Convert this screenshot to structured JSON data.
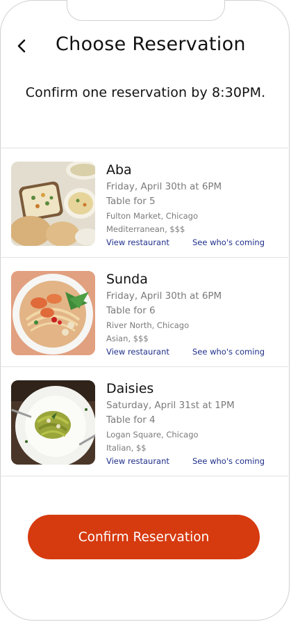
{
  "header": {
    "title": "Choose Reservation",
    "back_icon": "chevron-left-icon"
  },
  "subtitle": "Confirm one reservation by 8:30PM.",
  "reservations": [
    {
      "name": "Aba",
      "when": "Friday, April 30th at 6PM",
      "party": "Table for 5",
      "where": "Fulton Market, Chicago",
      "cuisine": "Mediterranean, $$$",
      "view_label": "View restaurant",
      "who_label": "See who's coming"
    },
    {
      "name": "Sunda",
      "when": "Friday, April 30th at 6PM",
      "party": "Table for 6",
      "where": "River North, Chicago",
      "cuisine": "Asian, $$$",
      "view_label": "View restaurant",
      "who_label": "See who's coming"
    },
    {
      "name": "Daisies",
      "when": "Saturday, April 31st at 1PM",
      "party": "Table for 4",
      "where": "Logan Square, Chicago",
      "cuisine": "Italian, $$",
      "view_label": "View restaurant",
      "who_label": "See who's coming"
    }
  ],
  "confirm_button": {
    "label": "Confirm Reservation",
    "color": "#d63a0f"
  },
  "colors": {
    "link": "#1f2f8a",
    "secondary_text": "#7a7a7a",
    "divider": "#e2e2e2"
  }
}
